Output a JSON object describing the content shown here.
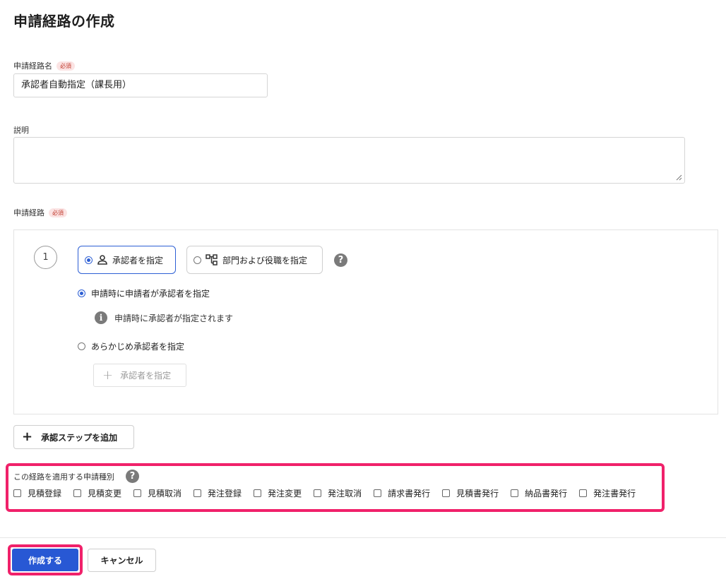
{
  "page": {
    "title": "申請経路の作成"
  },
  "route_name": {
    "label": "申請経路名",
    "required": "必須",
    "value": "承認者自動指定（課長用）"
  },
  "description": {
    "label": "説明",
    "value": ""
  },
  "route": {
    "label": "申請経路",
    "required": "必須",
    "step_number": "1",
    "approver_option": "承認者を指定",
    "dept_option": "部門および役職を指定",
    "help": "?",
    "radio_applicant": "申請時に申請者が承認者を指定",
    "info_text": "申請時に承認者が指定されます",
    "info_icon": "i",
    "radio_preset": "あらかじめ承認者を指定",
    "assign_button": "承認者を指定",
    "add_step_button": "承認ステップを追加",
    "plus": "+"
  },
  "apply": {
    "label": "この経路を適用する申請種別",
    "help": "?",
    "types": [
      "見積登録",
      "見積変更",
      "見積取消",
      "発注登録",
      "発注変更",
      "発注取消",
      "請求書発行",
      "見積書発行",
      "納品書発行",
      "発注書発行"
    ]
  },
  "footer": {
    "create_button": "作成する",
    "cancel_button": "キャンセル"
  },
  "colors": {
    "accent": "#2858d4",
    "highlight": "#f0216a",
    "required_badge": "#fbe3e3"
  },
  "icons": {
    "approver": "person-icon",
    "dept": "org-chart-icon",
    "help": "question-circle-icon",
    "info": "info-circle-icon"
  }
}
